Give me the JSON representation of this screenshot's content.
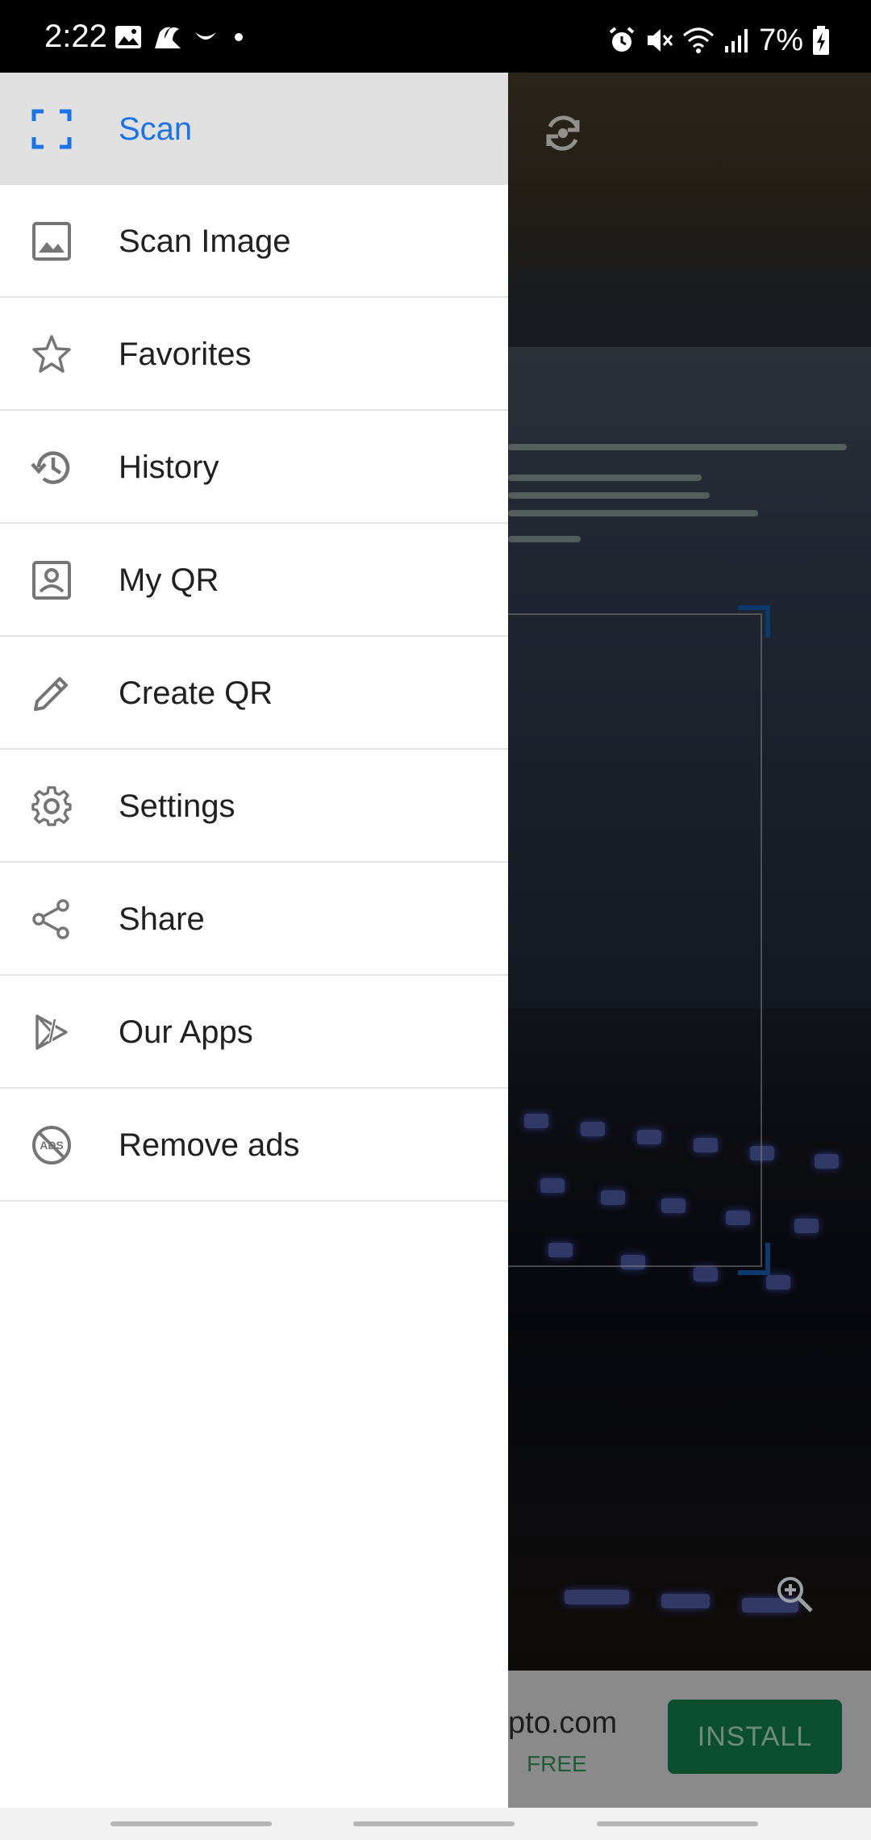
{
  "status_bar": {
    "time": "2:22",
    "battery_pct": "7%",
    "left_icons": [
      "image-notification-icon",
      "app-notification-icon",
      "night-mode-icon",
      "dot-icon"
    ],
    "right_icons": [
      "alarm-icon",
      "mute-icon",
      "wifi-icon",
      "signal-icon",
      "battery-charging-icon"
    ]
  },
  "drawer": {
    "items": [
      {
        "label": "Scan",
        "icon": "scan-frame-icon",
        "active": true
      },
      {
        "label": "Scan Image",
        "icon": "image-icon"
      },
      {
        "label": "Favorites",
        "icon": "star-icon"
      },
      {
        "label": "History",
        "icon": "history-icon"
      },
      {
        "label": "My QR",
        "icon": "contact-card-icon"
      },
      {
        "label": "Create QR",
        "icon": "pencil-icon"
      },
      {
        "label": "Settings",
        "icon": "gear-icon"
      },
      {
        "label": "Share",
        "icon": "share-icon"
      },
      {
        "label": "Our Apps",
        "icon": "apps-play-icon"
      },
      {
        "label": "Remove ads",
        "icon": "no-ads-icon"
      }
    ]
  },
  "camera": {
    "switch_icon": "camera-switch-icon",
    "zoom_icon": "zoom-in-icon"
  },
  "ad": {
    "domain": "pto.com",
    "price": "FREE",
    "install_label": "INSTALL"
  },
  "colors": {
    "accent": "#1a73e8",
    "active_bg": "#e0e0e0",
    "icon_gray": "#757575",
    "install_bg": "#0b4f30"
  }
}
